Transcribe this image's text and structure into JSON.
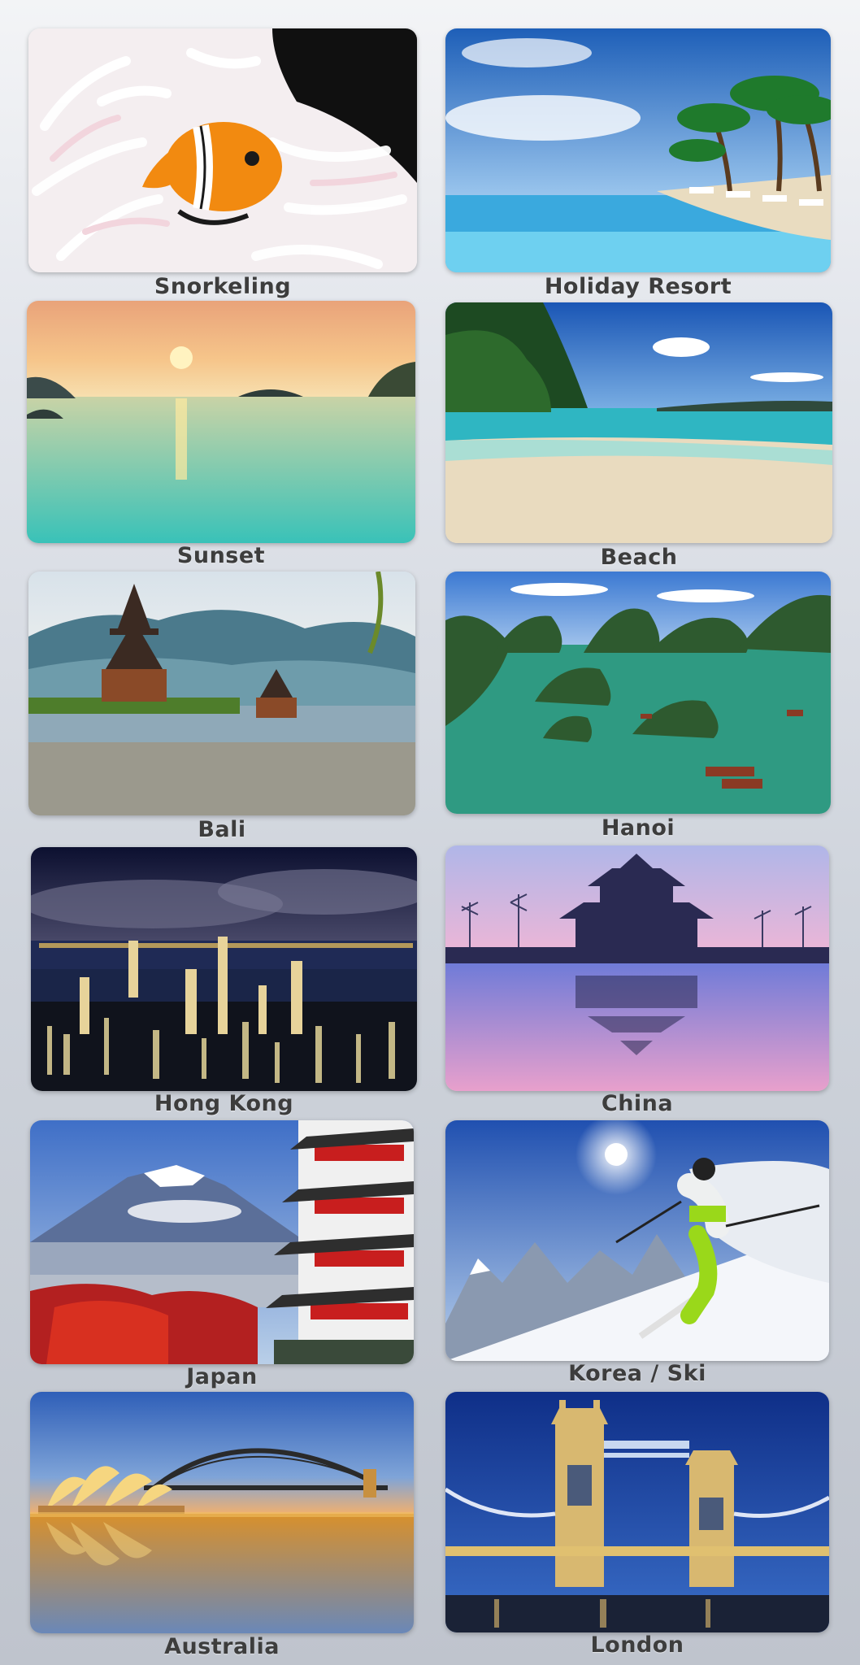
{
  "tiles": [
    {
      "label": "Snorkeling",
      "image": "clownfish-in-anemone"
    },
    {
      "label": "Holiday Resort",
      "image": "palm-pool-resort"
    },
    {
      "label": "Sunset",
      "image": "ocean-sunset"
    },
    {
      "label": "Beach",
      "image": "tropical-beach"
    },
    {
      "label": "Bali",
      "image": "bali-temple-lake"
    },
    {
      "label": "Hanoi",
      "image": "ha-long-bay"
    },
    {
      "label": "Hong Kong",
      "image": "hong-kong-night-skyline"
    },
    {
      "label": "China",
      "image": "forbidden-city-tower"
    },
    {
      "label": "Japan",
      "image": "mount-fuji-pagoda"
    },
    {
      "label": "Korea / Ski",
      "image": "skier-downhill"
    },
    {
      "label": "Australia",
      "image": "sydney-opera-house-bridge"
    },
    {
      "label": "London",
      "image": "tower-bridge-night"
    }
  ]
}
